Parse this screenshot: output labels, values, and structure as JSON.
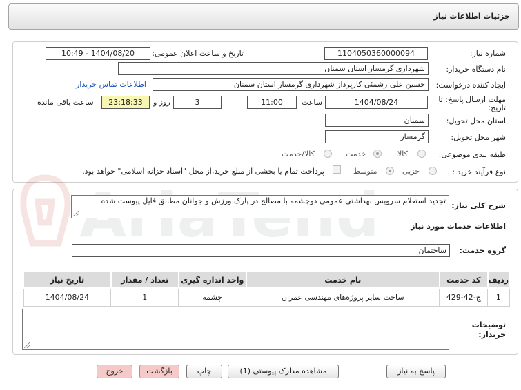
{
  "header": {
    "title": "جزئیات اطلاعات نیاز"
  },
  "form": {
    "need_number_label": "شماره نیاز:",
    "need_number": "1104050360000094",
    "announce_label": "تاریخ و ساعت اعلان عمومی:",
    "announce_value": "1404/08/20 - 10:49",
    "buyer_org_label": "نام دستگاه خریدار:",
    "buyer_org": "شهرداری گرمسار استان سمنان",
    "creator_label": "ایجاد کننده درخواست:",
    "creator": "حسین علی رشمئی کارپرداز شهرداری گرمسار استان سمنان",
    "contact_link": "اطلاعات تماس خریدار",
    "deadline_label_line1": "مهلت ارسال پاسخ: تا",
    "deadline_label_line2": "تاریخ:",
    "deadline_date": "1404/08/24",
    "time_label": "ساعت",
    "deadline_time": "11:00",
    "days_value": "3",
    "days_label": "روز و",
    "remaining_time": "23:18:33",
    "remaining_label": "ساعت باقی مانده",
    "province_label": "استان محل تحویل:",
    "province": "سمنان",
    "city_label": "شهر محل تحویل:",
    "city": "گرمسار",
    "category_label": "طبقه بندی موضوعی:",
    "category_options": [
      "کالا",
      "خدمت",
      "کالا/خدمت"
    ],
    "process_label": "نوع فرآیند خرید :",
    "process_options": [
      "جزیی",
      "متوسط"
    ],
    "payment_note": "پرداخت تمام یا بخشی از مبلغ خرید،از محل \"اسناد خزانه اسلامی\" خواهد بود."
  },
  "need": {
    "desc_label": "شرح کلی نیاز:",
    "description": "تجدید استعلام سرویس بهداشتی عمومی دوچشمه با مصالح در پارک ورزش و جوانان مطابق فایل پیوست شده",
    "services_heading": "اطلاعات خدمات مورد نیاز",
    "service_group_label": "گروه خدمت:",
    "service_group": "ساختمان",
    "table_headers": [
      "ردیف",
      "کد خدمت",
      "نام خدمت",
      "واحد اندازه گیری",
      "تعداد / مقدار",
      "تاریخ نیاز"
    ],
    "table_rows": [
      [
        "1",
        "ج-42-429",
        "ساخت سایر پروژه‌های مهندسی عمران",
        "چشمه",
        "1",
        "1404/08/24"
      ]
    ],
    "buyer_notes_label_line1": "توضیحات",
    "buyer_notes_label_line2": "خریدار:"
  },
  "buttons": {
    "reply": "پاسخ به نیاز",
    "attachments": "مشاهده مدارک پیوستی (1)",
    "print": "چاپ",
    "back": "بازگشت",
    "exit": "خروج"
  },
  "watermark": {
    "text": "AriaTender.net"
  }
}
